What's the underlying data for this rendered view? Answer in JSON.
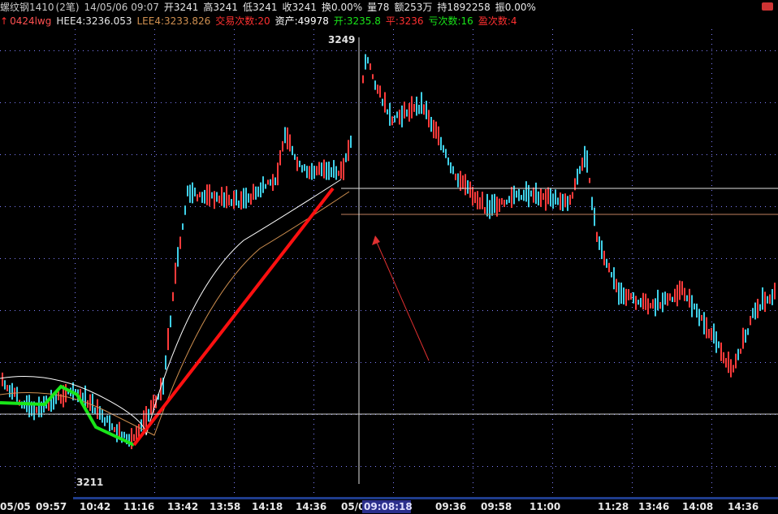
{
  "header": {
    "title": "螺纹钢1410",
    "period": "(2笔)",
    "datetime": "14/05/06 09:07",
    "open": "开3241",
    "high": "高3241",
    "low": "低3241",
    "close": "收3241",
    "turnover_rate": "换0.00%",
    "volume": "量78",
    "amount": "额253万",
    "open_interest": "持1892258",
    "amplitude": "振0.00%"
  },
  "indicator": {
    "arrow": "↑",
    "name": "0424lwg",
    "hee4": "HEE4:3236.053",
    "lee4": "LEE4:3233.826",
    "trades": "交易次数:20",
    "assets_label": "资产:",
    "assets_value": "49978",
    "open_val": "开:3235.8",
    "close_val": "平:3236",
    "loss_count": "亏次数:16",
    "profit_count": "盈次数:4"
  },
  "price_labels": {
    "high": "3249",
    "low": "3211"
  },
  "time_axis": [
    "05/05",
    "09:57",
    "10:42",
    "11:16",
    "13:42",
    "13:58",
    "14:18",
    "14:36",
    "05/0",
    "09:36",
    "09:58",
    "11:00",
    "11:28",
    "13:46",
    "14:08",
    "14:36"
  ],
  "cursor_time": "09:08:18",
  "colors": {
    "up": "#ff3b3b",
    "down": "#3fd0e8",
    "signal_up": "#ff1010",
    "signal_down": "#19e619",
    "grid": "#8080ff",
    "hee": "#ffffff",
    "lee": "#d09050",
    "arrow": "#e03030"
  },
  "icons": {
    "menu": "menu-icon"
  }
}
